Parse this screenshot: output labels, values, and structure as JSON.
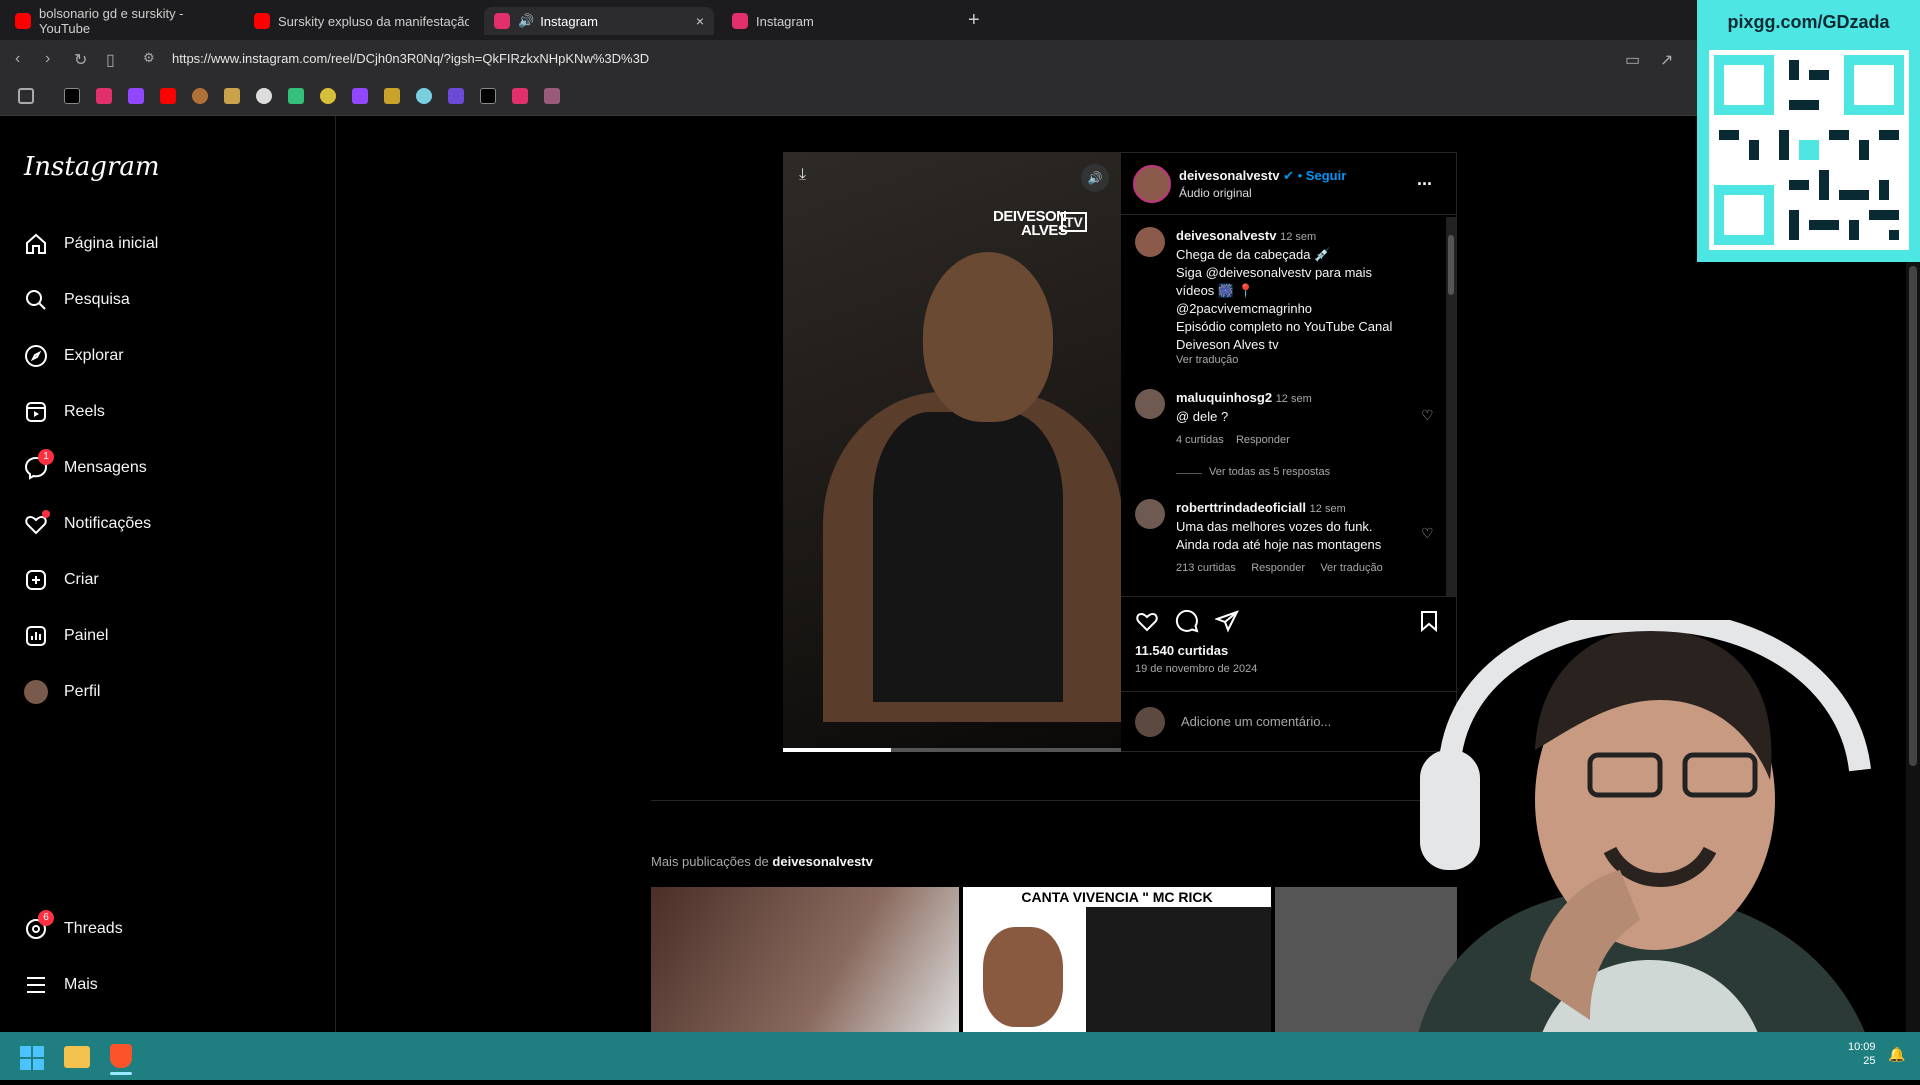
{
  "browser": {
    "tabs": [
      {
        "label": "bolsonario gd e surskity - YouTube",
        "color": "#ff0000"
      },
      {
        "label": "Surskity expluso da manifestação d",
        "color": "#ff0000"
      },
      {
        "label": "Instagram",
        "color": "#e1306c",
        "active": true
      },
      {
        "label": "Instagram",
        "color": "#e1306c"
      }
    ],
    "new_tab": "+",
    "close_tab": "×",
    "url": "https://www.instagram.com/reel/DCjh0n3R0Nq/?igsh=QkFIRzkxNHpKNw%3D%3D"
  },
  "sidebar": {
    "logo": "Instagram",
    "items": [
      {
        "label": "Página inicial",
        "icon": "home-icon"
      },
      {
        "label": "Pesquisa",
        "icon": "search-icon"
      },
      {
        "label": "Explorar",
        "icon": "compass-icon"
      },
      {
        "label": "Reels",
        "icon": "reels-icon"
      },
      {
        "label": "Mensagens",
        "icon": "messenger-icon",
        "badge": "1"
      },
      {
        "label": "Notificações",
        "icon": "heart-icon",
        "dot": true
      },
      {
        "label": "Criar",
        "icon": "plus-square-icon"
      },
      {
        "label": "Painel",
        "icon": "dashboard-icon"
      },
      {
        "label": "Perfil",
        "icon": "avatar"
      }
    ],
    "bottom_items": [
      {
        "label": "Threads",
        "icon": "threads-icon",
        "badge": "6"
      },
      {
        "label": "Mais",
        "icon": "menu-icon"
      }
    ]
  },
  "post": {
    "video_watermark_1": "DEIVESON",
    "video_watermark_2": "ALVES",
    "video_watermark_tv": "TV",
    "video_progress": 0.32,
    "author": "deivesonalvestv",
    "follow": "Seguir",
    "dot_sep": "•",
    "audio": "Áudio original",
    "more": "...",
    "caption_author": "deivesonalvestv",
    "caption_time": "12 sem",
    "caption_lines": [
      "Chega de da cabeçada 💉",
      "Siga @deivesonalvestv para mais",
      "vídeos 🎆 📍",
      "@2pacvivemcmagrinho",
      "Episódio completo no YouTube Canal",
      "Deiveson Alves tv"
    ],
    "see_translation": "Ver tradução",
    "comments": [
      {
        "user": "maluquinhosg2",
        "time": "12 sem",
        "text": [
          "@ dele ?"
        ],
        "likes": "4 curtidas",
        "reply": "Responder",
        "view_replies": "Ver todas as 5 respostas"
      },
      {
        "user": "roberttrindadeoficiall",
        "time": "12 sem",
        "text": [
          "Uma das melhores vozes do funk.",
          "Ainda roda até hoje nas montagens"
        ],
        "likes": "213 curtidas",
        "reply": "Responder",
        "translate": "Ver tradução"
      }
    ],
    "likes_count": "11.540 curtidas",
    "date": "19 de novembro de 2024",
    "comment_placeholder": "Adicione um comentário..."
  },
  "more_posts": {
    "label_prefix": "Mais publicações de ",
    "label_user": "deivesonalvestv",
    "thumb2_text": "CANTA VIVENCIA \" MC RICK"
  },
  "overlay": {
    "qr_title": "pixgg.com/GDzada"
  },
  "taskbar": {
    "time": "10:09",
    "date": "25"
  }
}
